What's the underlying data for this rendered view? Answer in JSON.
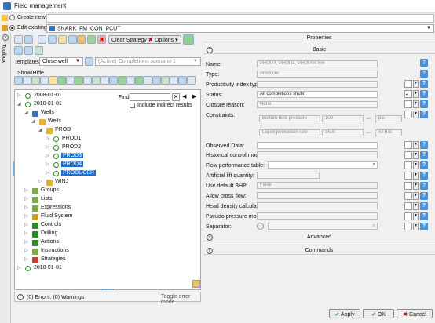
{
  "window": {
    "title": "Field management"
  },
  "modes": {
    "create_label": "Create new:",
    "edit_label": "Edit existing:",
    "edit_value": "SNARK_FM_CON_PCUT"
  },
  "toolbar": {
    "clear_strategy": "Clear Strategy",
    "options": "Options"
  },
  "toolbox": {
    "label": "Toolbox"
  },
  "templates": {
    "label": "Templates:",
    "value": "Close well",
    "scenario_placeholder": "(Active) Completions scenario 1"
  },
  "showhide": {
    "label": "Show/Hide"
  },
  "find": {
    "label": "Find:",
    "include_label": "Include indirect results"
  },
  "tree": [
    {
      "label": "2008-01-01"
    },
    {
      "label": "2010-01-01"
    },
    {
      "label": "Wells"
    },
    {
      "label": "Wells"
    },
    {
      "label": "PROD"
    },
    {
      "label": "PROD1"
    },
    {
      "label": "PROD2"
    },
    {
      "label": "PROD3"
    },
    {
      "label": "PROD4"
    },
    {
      "label": "PRODUCER"
    },
    {
      "label": "WINJ"
    },
    {
      "label": "Groups"
    },
    {
      "label": "Lists"
    },
    {
      "label": "Expressions"
    },
    {
      "label": "Fluid System"
    },
    {
      "label": "Controls"
    },
    {
      "label": "Drilling"
    },
    {
      "label": "Actions"
    },
    {
      "label": "Instructions"
    },
    {
      "label": "Strategies"
    },
    {
      "label": "2018-01-01"
    }
  ],
  "status": {
    "text": "(0) Errors, (0) Warnings",
    "toggle": "Toggle error mode"
  },
  "properties": {
    "title": "Properties",
    "basic": "Basic",
    "name_label": "Name:",
    "name_value": "PROD3, PROD4, PRODUCER",
    "type_label": "Type:",
    "type_value": "Producer",
    "pit_label": "Productivity index type:",
    "status_label": "Status:",
    "status_value": "All completions shutin",
    "closure_label": "Closure reason:",
    "closure_value": "None",
    "constraints_label": "Constraints:",
    "c1_name": "Bottom hole pressure",
    "c1_value": "100",
    "c1_unit": "psi",
    "c2_name": "Liquid production rate",
    "c2_value": "3500",
    "c2_unit": "STB/d",
    "obs_label": "Observed Data:",
    "hist_label": "Historical control modes:",
    "flow_label": "Flow performance table:",
    "lift_label": "Artificial lift quantity:",
    "bhp_label": "Use default BHP:",
    "bhp_value": "False",
    "cross_label": "Allow cross flow:",
    "head_label": "Head density calculation:",
    "pseudo_label": "Pseudo pressure model:",
    "sep_label": "Separator:",
    "advanced": "Advanced",
    "commands": "Commands"
  },
  "buttons": {
    "apply": "Apply",
    "ok": "OK",
    "cancel": "Cancel"
  },
  "colors": {
    "selection": "#1a6fd1",
    "help": "#4a90d9"
  }
}
